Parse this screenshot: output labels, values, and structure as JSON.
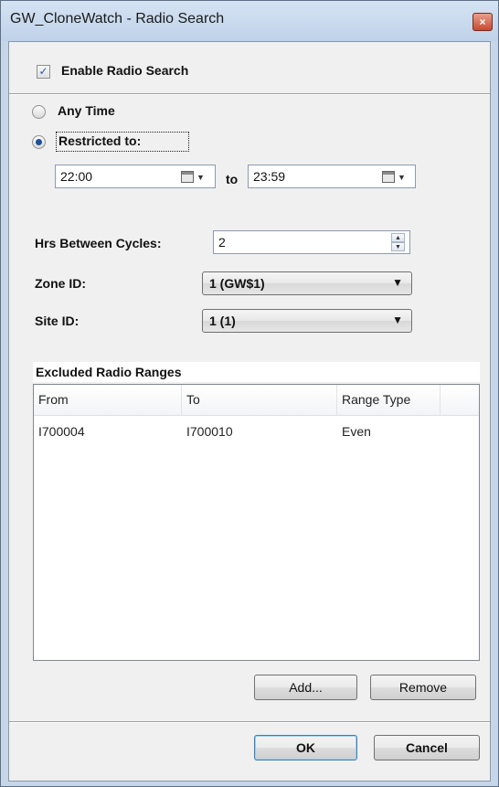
{
  "window": {
    "title": "GW_CloneWatch - Radio Search",
    "close_glyph": "×"
  },
  "enable": {
    "label": "Enable Radio Search",
    "checked": true,
    "check_glyph": "✓"
  },
  "schedule": {
    "any_time_label": "Any Time",
    "restricted_label": "Restricted to:",
    "selected": "restricted",
    "from_time": "22:00",
    "to_label": "to",
    "to_time": "23:59"
  },
  "settings": {
    "hrs_label": "Hrs Between Cycles:",
    "hrs_value": "2",
    "zone_label": "Zone ID:",
    "zone_value": "1 (GW$1)",
    "site_label": "Site ID:",
    "site_value": "1 (1)"
  },
  "excluded": {
    "title": "Excluded Radio Ranges",
    "columns": [
      "From",
      "To",
      "Range Type"
    ],
    "rows": [
      {
        "from": "I700004",
        "to": "I700010",
        "type": "Even"
      }
    ]
  },
  "buttons": {
    "add": "Add...",
    "remove": "Remove",
    "ok": "OK",
    "cancel": "Cancel"
  },
  "icons": {
    "dropdown": "▼",
    "spin_up": "▲",
    "spin_down": "▼"
  },
  "colors": {
    "title_bar": "#c6d6e8",
    "client": "#f0f0f0",
    "radio_selected": "#1e4f9b",
    "close_button": "#c64a30"
  }
}
